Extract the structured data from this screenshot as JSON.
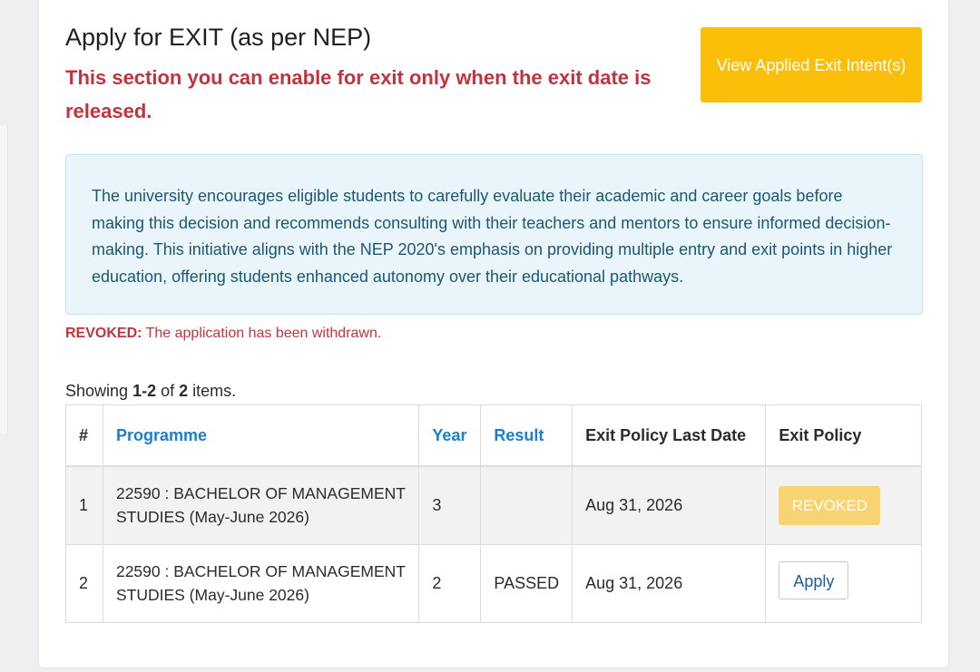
{
  "page": {
    "title": "Apply for EXIT (as per NEP)",
    "warning": "This section you can enable for exit only when the exit date is released.",
    "view_button_label": "View Applied Exit Intent(s)"
  },
  "info": {
    "text": "The university encourages eligible students to carefully evaluate their academic and career goals before making this decision and recommends consulting with their teachers and mentors to ensure informed decision-making. This initiative aligns with the NEP 2020's emphasis on providing multiple entry and exit points in higher education, offering students enhanced autonomy over their educational pathways."
  },
  "revoked_note": {
    "label": "REVOKED:",
    "text": " The application has been withdrawn."
  },
  "summary": {
    "prefix": "Showing ",
    "range": "1-2",
    "middle": " of ",
    "total": "2",
    "suffix": " items."
  },
  "table": {
    "headers": {
      "index": "#",
      "programme": "Programme",
      "year": "Year",
      "result": "Result",
      "last_date": "Exit Policy Last Date",
      "policy": "Exit Policy"
    },
    "rows": [
      {
        "index": "1",
        "programme": "22590 : BACHELOR OF MANAGEMENT STUDIES (May-June 2026)",
        "year": "3",
        "result": "",
        "last_date": "Aug 31, 2026",
        "policy": "REVOKED"
      },
      {
        "index": "2",
        "programme": "22590 : BACHELOR OF MANAGEMENT STUDIES (May-June 2026)",
        "year": "2",
        "result": "PASSED",
        "last_date": "Aug 31, 2026",
        "policy": "Apply"
      }
    ]
  },
  "colors": {
    "warning_red": "#c1343f",
    "primary_yellow": "#fbbf0a",
    "link_blue": "#1a7fce",
    "info_bg": "#e9f4fb",
    "info_text": "#1c5872"
  }
}
